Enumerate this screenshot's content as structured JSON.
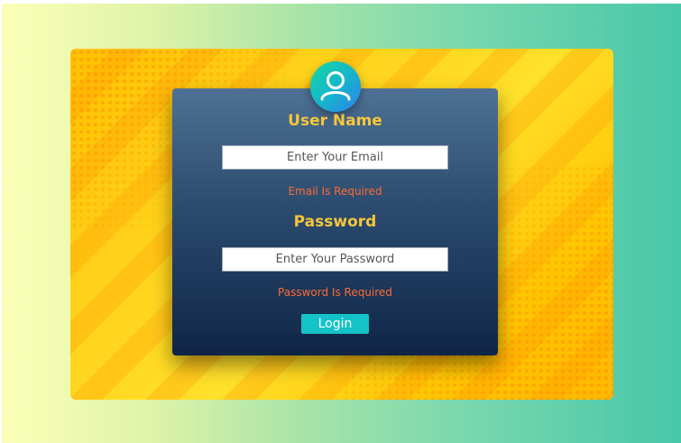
{
  "form": {
    "username_label": "User Name",
    "email": {
      "value": "",
      "placeholder": "Enter Your Email",
      "error": "Email Is Required"
    },
    "password_label": "Password",
    "password": {
      "value": "",
      "placeholder": "Enter Your Password",
      "error": "Password Is Required"
    },
    "login_label": "Login"
  },
  "icons": {
    "avatar": "user-icon"
  },
  "colors": {
    "label": "#f6c63a",
    "error": "#ff6a33",
    "button": "#13c3c8",
    "card_top": "#4e7194",
    "card_bottom": "#0f2546"
  }
}
